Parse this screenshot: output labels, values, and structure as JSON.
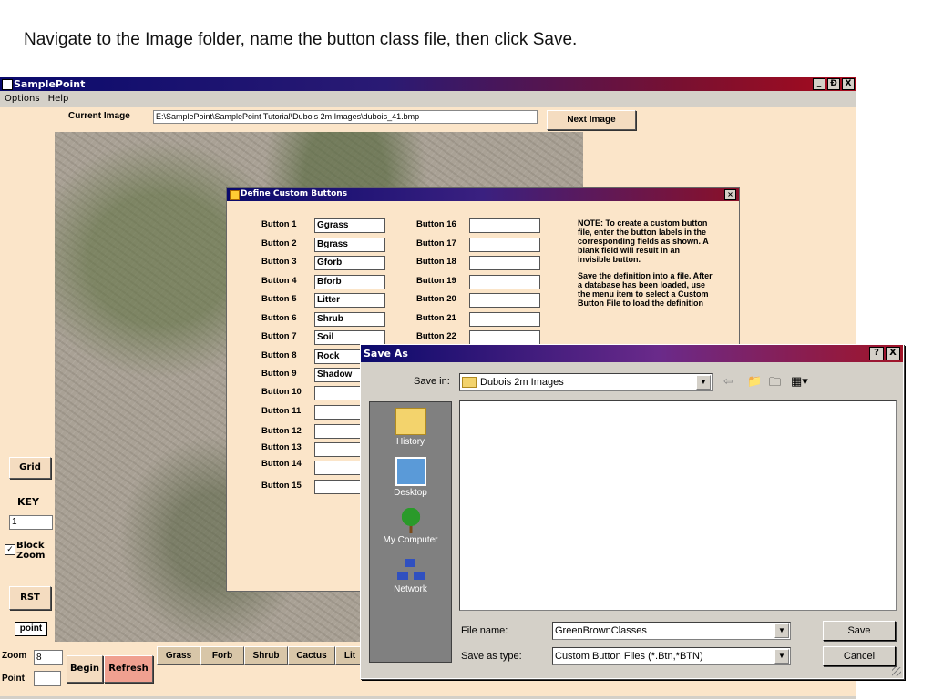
{
  "instruction": "Navigate to the Image folder, name the button class file, then click Save.",
  "app": {
    "title": "SamplePoint",
    "window_buttons": [
      "_",
      "Ɖ",
      "X"
    ],
    "menu": [
      "Options",
      "Help"
    ],
    "current_image_label": "Current Image",
    "current_image_path": "E:\\SamplePoint\\SamplePoint  Tutorial\\Dubois  2m  Images\\dubois_41.bmp",
    "next_image_label": "Next Image",
    "grid_label": "Grid",
    "key_label": "KEY",
    "key_value": "1",
    "block_zoom_label": "Block Zoom",
    "block_zoom_checked": "✓",
    "rst_label": "RST",
    "point_box": "point",
    "zoom_label": "Zoom",
    "zoom_value": "8",
    "point_label": "Point",
    "begin_label": "Begin",
    "refresh_label": "Refresh",
    "category_buttons": [
      "Grass",
      "Forb",
      "Shrub",
      "Cactus",
      "Lit"
    ]
  },
  "custom_buttons_dialog": {
    "title": "Define Custom Buttons",
    "close": "×",
    "buttons": [
      {
        "label": "Button 1",
        "value": "Ggrass"
      },
      {
        "label": "Button 2",
        "value": "Bgrass"
      },
      {
        "label": "Button 3",
        "value": "Gforb"
      },
      {
        "label": "Button 4",
        "value": "Bforb"
      },
      {
        "label": "Button 5",
        "value": "Litter"
      },
      {
        "label": "Button 6",
        "value": "Shrub"
      },
      {
        "label": "Button 7",
        "value": "Soil"
      },
      {
        "label": "Button 8",
        "value": "Rock"
      },
      {
        "label": "Button 9",
        "value": "Shadow"
      },
      {
        "label": "Button 10",
        "value": ""
      },
      {
        "label": "Button 11",
        "value": ""
      },
      {
        "label": "Button 12",
        "value": ""
      },
      {
        "label": "Button 13",
        "value": ""
      },
      {
        "label": "Button 14",
        "value": ""
      },
      {
        "label": "Button 15",
        "value": ""
      },
      {
        "label": "Button 16",
        "value": ""
      },
      {
        "label": "Button 17",
        "value": ""
      },
      {
        "label": "Button 18",
        "value": ""
      },
      {
        "label": "Button 19",
        "value": ""
      },
      {
        "label": "Button 20",
        "value": ""
      },
      {
        "label": "Button 21",
        "value": ""
      },
      {
        "label": "Button 22",
        "value": ""
      }
    ],
    "note_1": "NOTE: To create a custom button file, enter the button labels in the corresponding fields as shown.  A blank field will result in an invisible button.",
    "note_2": "Save the definition into a file. After a database has been loaded, use the menu item to select a Custom Button File to load the definition into the database."
  },
  "save_dialog": {
    "title": "Save As",
    "help_btn": "?",
    "close_btn": "X",
    "save_in_label": "Save in:",
    "save_in_value": "Dubois 2m Images",
    "places": [
      "History",
      "Desktop",
      "My Computer",
      "Network"
    ],
    "file_name_label": "File name:",
    "file_name_value": "GreenBrownClasses",
    "save_type_label": "Save as type:",
    "save_type_value": "Custom Button Files  (*.Btn,*BTN)",
    "save_button": "Save",
    "cancel_button": "Cancel"
  }
}
